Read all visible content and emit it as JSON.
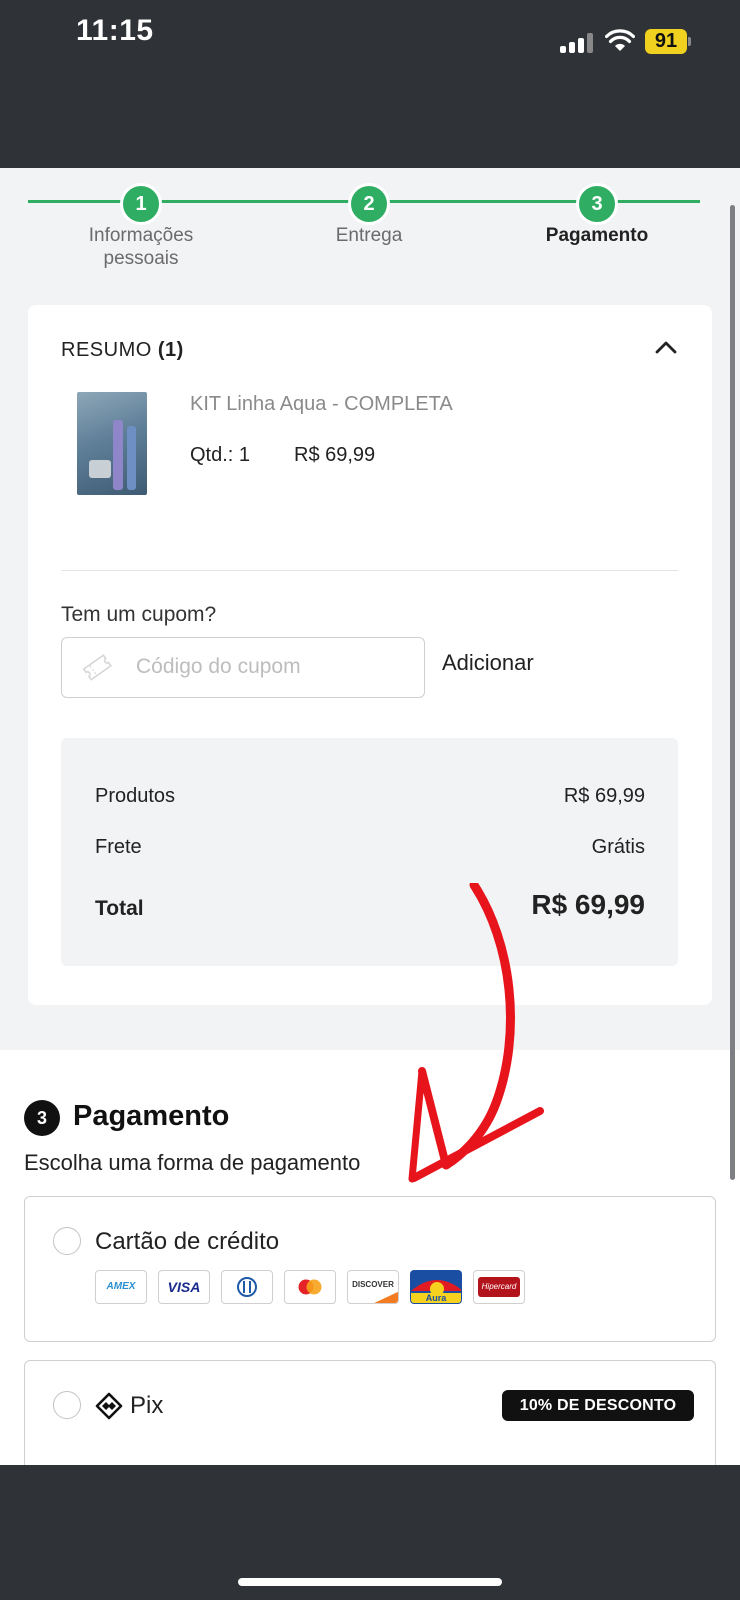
{
  "status_bar": {
    "time": "11:15",
    "battery": "91"
  },
  "stepper": {
    "steps": [
      {
        "number": "1",
        "label_line1": "Informações",
        "label_line2": "pessoais"
      },
      {
        "number": "2",
        "label_line1": "Entrega",
        "label_line2": ""
      },
      {
        "number": "3",
        "label_line1": "Pagamento",
        "label_line2": ""
      }
    ],
    "active_step": 3,
    "color": "#2fae63"
  },
  "summary": {
    "title": "RESUMO",
    "count": "(1)",
    "product": {
      "name": "KIT Linha Aqua - COMPLETA",
      "qty": "Qtd.: 1",
      "price": "R$ 69,99"
    },
    "coupon": {
      "label": "Tem um cupom?",
      "placeholder": "Código do cupom",
      "button": "Adicionar"
    },
    "totals": {
      "produtos_label": "Produtos",
      "produtos_value": "R$ 69,99",
      "frete_label": "Frete",
      "frete_value": "Grátis",
      "total_label": "Total",
      "total_value": "R$ 69,99"
    }
  },
  "payment": {
    "number": "3",
    "title": "Pagamento",
    "subtitle": "Escolha uma forma de pagamento",
    "options": [
      {
        "label": "Cartão de crédito",
        "brands": [
          "AMEX",
          "VISA",
          "Diners",
          "Mastercard",
          "DISCOVER",
          "Aura",
          "Hipercard"
        ]
      },
      {
        "label": "Pix",
        "badge": "10% DE DESCONTO"
      }
    ]
  },
  "annotation": {
    "color": "#e8141c",
    "shape": "hand-drawn-arrow"
  }
}
